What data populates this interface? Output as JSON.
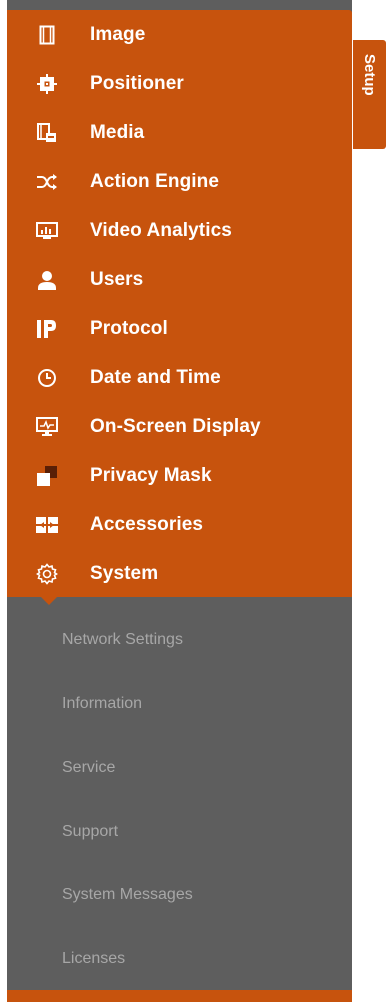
{
  "colors": {
    "accent": "#c7530d",
    "submenu_bg": "#5e5e5e",
    "submenu_text": "#a7a7a7",
    "menu_text": "#ffffff"
  },
  "menu": {
    "items": [
      {
        "label": "Image",
        "icon": "film-icon"
      },
      {
        "label": "Positioner",
        "icon": "positioner-icon"
      },
      {
        "label": "Media",
        "icon": "media-icon"
      },
      {
        "label": "Action Engine",
        "icon": "shuffle-icon"
      },
      {
        "label": "Video Analytics",
        "icon": "analytics-monitor-icon"
      },
      {
        "label": "Users",
        "icon": "user-icon"
      },
      {
        "label": "Protocol",
        "icon": "ip-icon"
      },
      {
        "label": "Date and Time",
        "icon": "clock-icon"
      },
      {
        "label": "On-Screen Display",
        "icon": "monitor-icon"
      },
      {
        "label": "Privacy Mask",
        "icon": "privacy-mask-icon"
      },
      {
        "label": "Accessories",
        "icon": "accessories-icon"
      },
      {
        "label": "System",
        "icon": "gear-icon"
      }
    ]
  },
  "submenu": {
    "items": [
      {
        "label": "Network Settings"
      },
      {
        "label": "Information"
      },
      {
        "label": "Service"
      },
      {
        "label": "Support"
      },
      {
        "label": "System Messages"
      },
      {
        "label": "Licenses"
      }
    ]
  },
  "setup_tab": {
    "label": "Setup"
  }
}
